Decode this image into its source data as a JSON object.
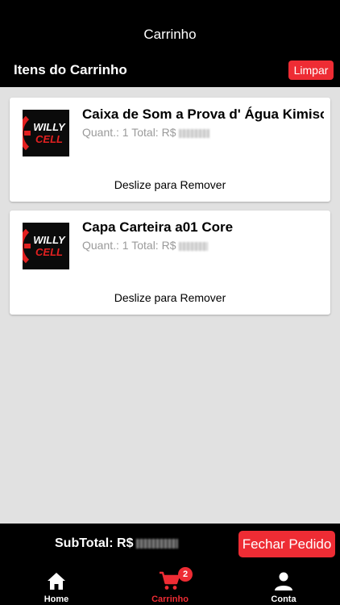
{
  "header": {
    "title": "Carrinho",
    "section_title": "Itens do Carrinho",
    "clear_label": "Limpar"
  },
  "cart": {
    "items": [
      {
        "name": "Caixa de Som a Prova d' Água Kimiso",
        "meta": "Quant.: 1 Total: R$",
        "swipe_hint": "Deslize para Remover",
        "logo_text_top": "WILLY",
        "logo_text_bottom": "CELL"
      },
      {
        "name": "Capa Carteira a01 Core",
        "meta": "Quant.: 1 Total: R$",
        "swipe_hint": "Deslize para Remover",
        "logo_text_top": "WILLY",
        "logo_text_bottom": "CELL"
      }
    ]
  },
  "footer": {
    "subtotal_label": "SubTotal: R$",
    "checkout_label": "Fechar Pedido"
  },
  "tabs": [
    {
      "label": "Home",
      "icon": "home-icon"
    },
    {
      "label": "Carrinho",
      "icon": "cart-icon",
      "badge": "2"
    },
    {
      "label": "Conta",
      "icon": "account-icon"
    }
  ],
  "colors": {
    "accent": "#ee2c34",
    "background": "#e1e1e1",
    "bar": "#000000"
  }
}
